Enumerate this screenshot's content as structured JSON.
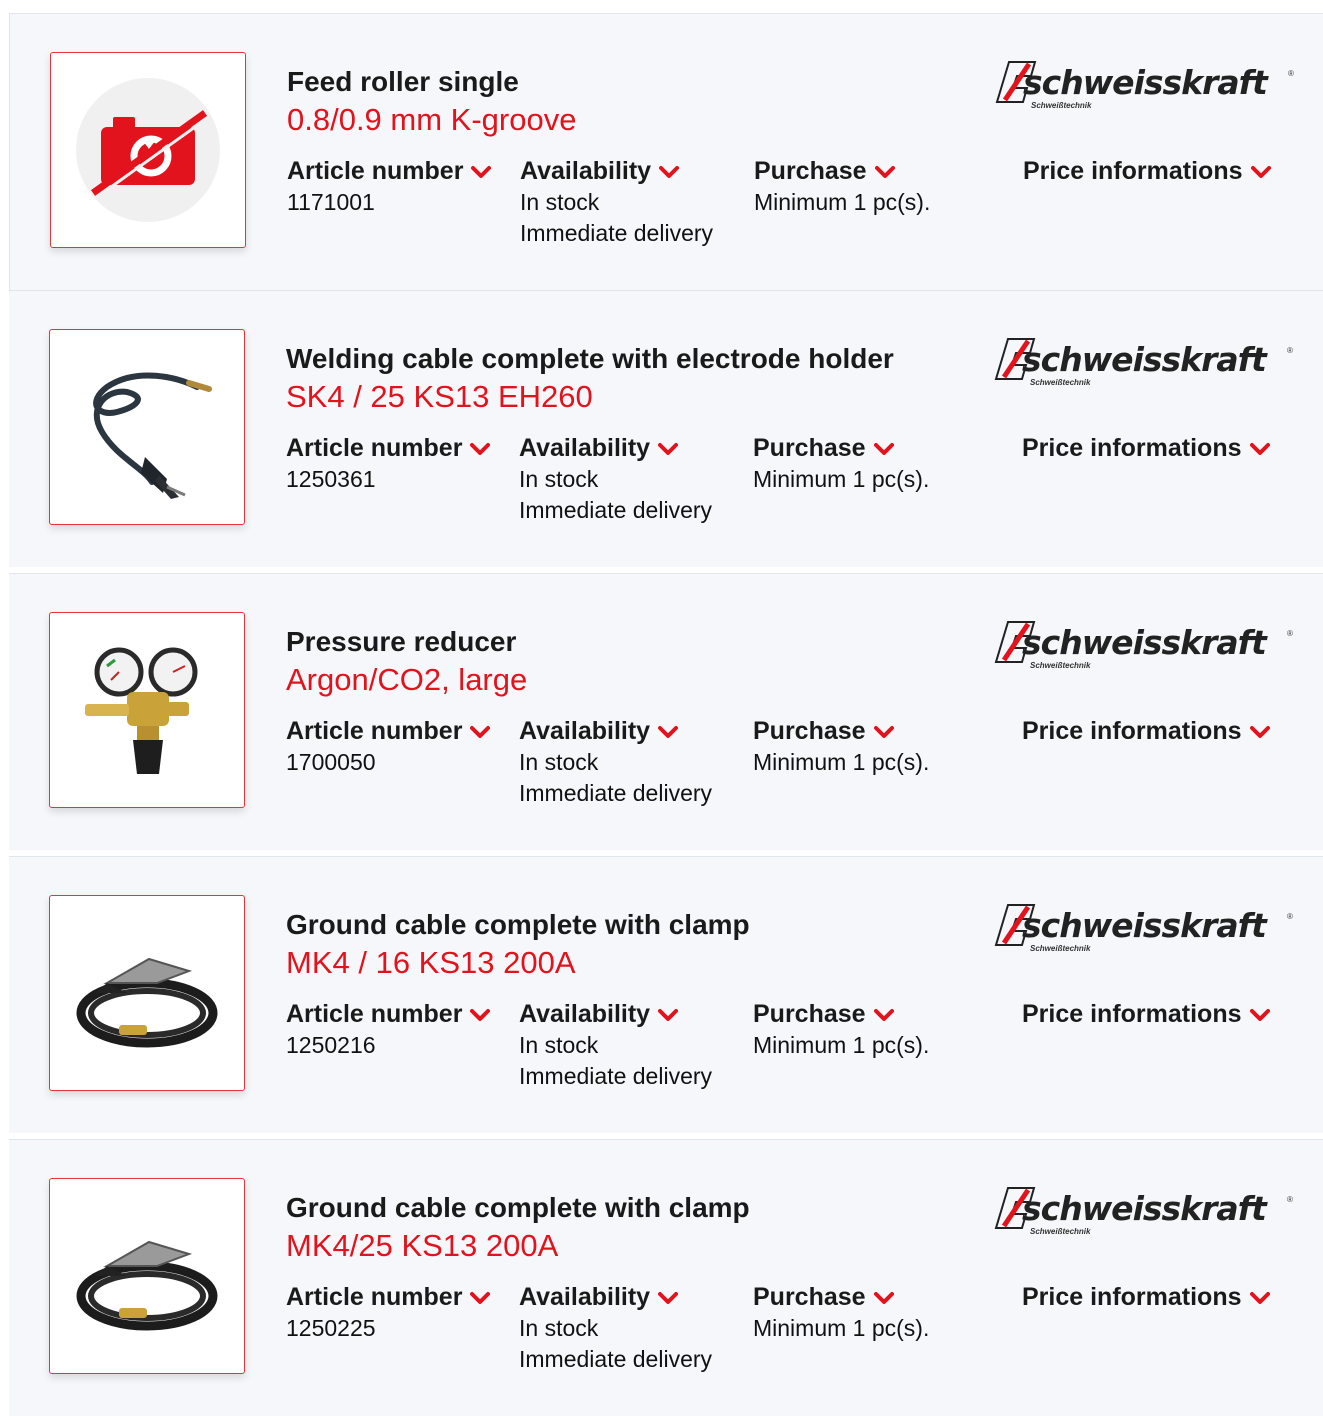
{
  "brand": {
    "logo_text": "schweisskraft",
    "logo_subtext": "Schweißtechnik",
    "registered_mark": "®"
  },
  "labels": {
    "article_number": "Article number",
    "availability": "Availability",
    "purchase": "Purchase",
    "price_informations": "Price informations"
  },
  "colors": {
    "accent": "#e2131d",
    "card_bg": "#f5f7fa",
    "border": "#dfe6ee"
  },
  "products": [
    {
      "title": "Feed roller single",
      "subtitle": "0.8/0.9 mm K-groove",
      "article_number": "1171001",
      "stock": "In stock",
      "delivery": "Immediate delivery",
      "minimum": "Minimum 1 pc(s).",
      "image": "no-image-placeholder-icon"
    },
    {
      "title": "Welding cable complete with electrode holder",
      "subtitle": "SK4 / 25 KS13 EH260",
      "article_number": "1250361",
      "stock": "In stock",
      "delivery": "Immediate delivery",
      "minimum": "Minimum 1 pc(s).",
      "image": "welding-cable-electrode-holder"
    },
    {
      "title": "Pressure reducer",
      "subtitle": "Argon/CO2, large",
      "article_number": "1700050",
      "stock": "In stock",
      "delivery": "Immediate delivery",
      "minimum": "Minimum 1 pc(s).",
      "image": "pressure-reducer"
    },
    {
      "title": "Ground cable complete with clamp",
      "subtitle": "MK4 / 16 KS13 200A",
      "article_number": "1250216",
      "stock": "In stock",
      "delivery": "Immediate delivery",
      "minimum": "Minimum 1 pc(s).",
      "image": "ground-cable-clamp"
    },
    {
      "title": "Ground cable complete with clamp",
      "subtitle": "MK4/25 KS13 200A",
      "article_number": "1250225",
      "stock": "In stock",
      "delivery": "Immediate delivery",
      "minimum": "Minimum 1 pc(s).",
      "image": "ground-cable-clamp"
    }
  ]
}
